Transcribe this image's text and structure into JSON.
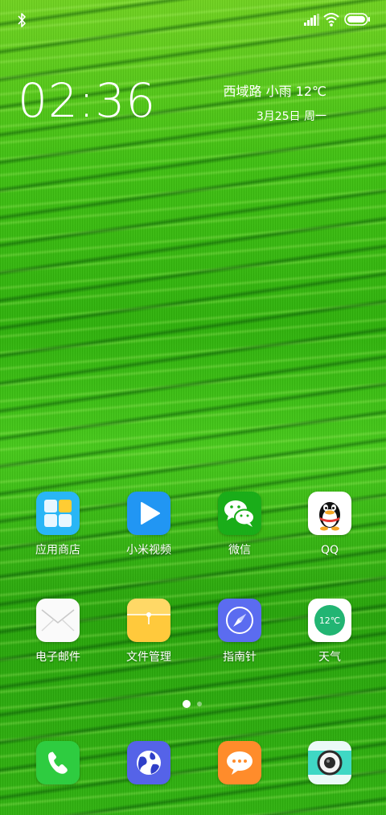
{
  "status_bar": {
    "left_icon": "bluetooth-icon",
    "right_icons": [
      "signal-icon",
      "wifi-icon",
      "battery-icon"
    ]
  },
  "clock": {
    "time": "02:36"
  },
  "weather": {
    "location_line": "西域路 小雨 12℃",
    "date_line": "3月25日 周一"
  },
  "apps": [
    {
      "label": "应用商店",
      "icon": "app-store-icon"
    },
    {
      "label": "小米视频",
      "icon": "video-play-icon"
    },
    {
      "label": "微信",
      "icon": "wechat-icon"
    },
    {
      "label": "QQ",
      "icon": "qq-penguin-icon"
    },
    {
      "label": "电子邮件",
      "icon": "mail-envelope-icon"
    },
    {
      "label": "文件管理",
      "icon": "folder-icon"
    },
    {
      "label": "指南针",
      "icon": "compass-icon"
    },
    {
      "label": "天气",
      "icon": "weather-icon",
      "badge": "12℃"
    }
  ],
  "dock": [
    {
      "icon": "phone-icon"
    },
    {
      "icon": "browser-globe-icon"
    },
    {
      "icon": "messages-icon"
    },
    {
      "icon": "camera-icon"
    }
  ],
  "pager": {
    "pages": 2,
    "current": 1
  },
  "colors": {
    "wallpaper_green": "#2eb10b",
    "app_store": "#29b6f6",
    "video": "#2196f3",
    "wechat": "#1aad19",
    "folder": "#ffc93c",
    "compass": "#5b6cf0",
    "phone": "#2ecc40",
    "messages": "#ff8c2b",
    "camera_teal": "#3fd8c4"
  }
}
